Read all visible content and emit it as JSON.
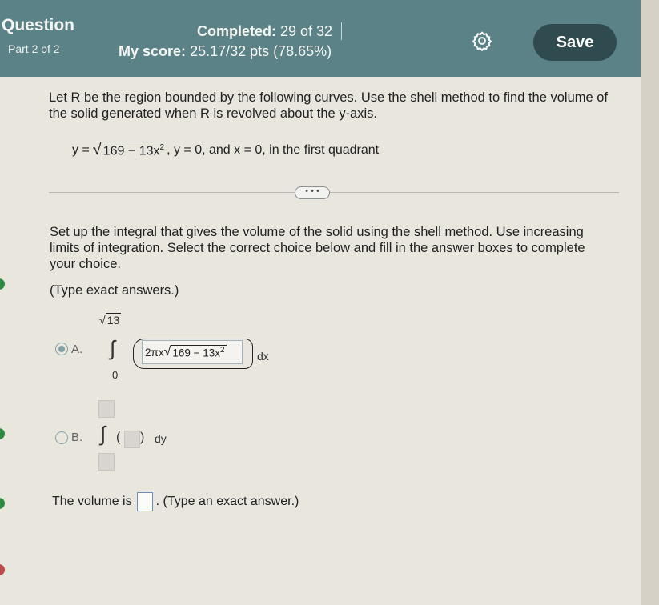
{
  "header": {
    "title": "Question",
    "part": "Part 2 of 2",
    "completed_label": "Completed:",
    "completed_value": "29 of 32",
    "score_label": "My score:",
    "score_value": "25.17/32 pts (78.65%)",
    "save_label": "Save",
    "settings_icon": "gear-icon"
  },
  "problem": {
    "text": "Let R be the region bounded by the following curves. Use the shell method to find the volume of the solid generated when R is revolved about the y-axis.",
    "eq_y": "y =",
    "eq_radicand": "169 − 13x",
    "eq_exp": "2",
    "eq_rest": ", y = 0, and x = 0, in the first quadrant"
  },
  "more_button": "• • •",
  "instructions": "Set up the integral that gives the volume of the solid using the shell method. Use increasing limits of integration. Select the correct choice below and fill in the answer boxes to complete your choice.",
  "type_exact": "(Type exact answers.)",
  "choice_a": {
    "label": "A.",
    "upper_limit": "13",
    "lower_limit": "0",
    "integrand_prefix": "2πx",
    "integrand_radicand": "169 − 13x",
    "integrand_exp": "2",
    "differential": "dx",
    "selected": true
  },
  "choice_b": {
    "label": "B.",
    "paren_open": "(",
    "paren_close": ")",
    "differential": "dy",
    "selected": false
  },
  "volume": {
    "prefix": "The volume is",
    "suffix": ". (Type an exact answer.)"
  }
}
